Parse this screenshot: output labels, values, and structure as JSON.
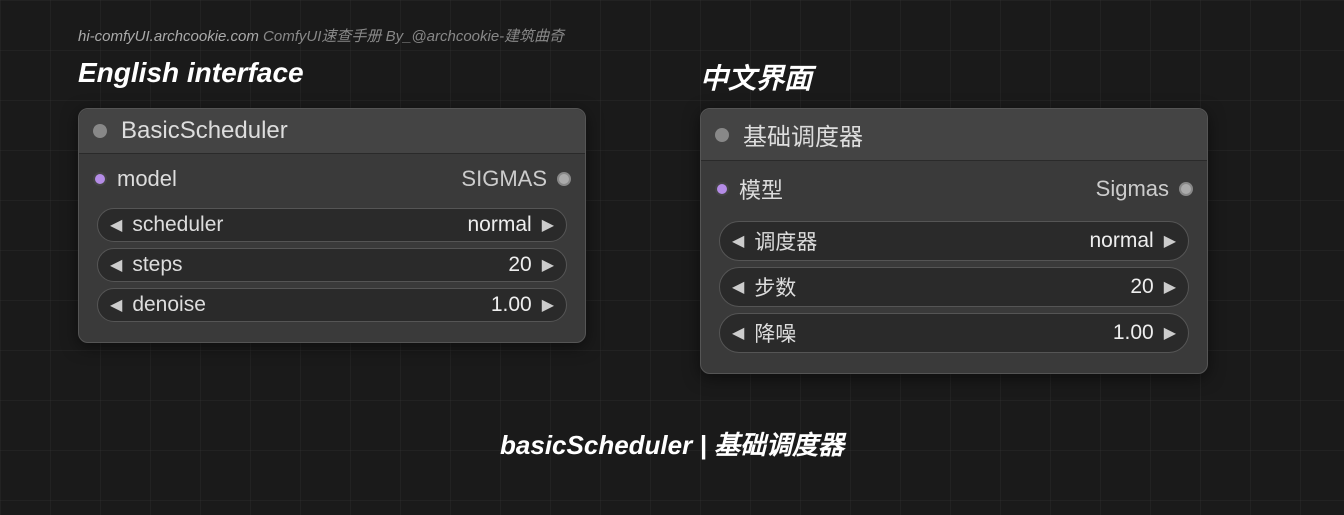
{
  "watermark": {
    "url": "hi-comfyUI.archcookie.com",
    "text": " ComfyUI速查手册 By_@archcookie-建筑曲奇"
  },
  "labels": {
    "english": "English interface",
    "chinese": "中文界面"
  },
  "caption": "basicScheduler | 基础调度器",
  "left_node": {
    "title": "BasicScheduler",
    "input_label": "model",
    "output_label": "SIGMAS",
    "widgets": {
      "scheduler": {
        "label": "scheduler",
        "value": "normal"
      },
      "steps": {
        "label": "steps",
        "value": "20"
      },
      "denoise": {
        "label": "denoise",
        "value": "1.00"
      }
    }
  },
  "right_node": {
    "title": "基础调度器",
    "input_label": "模型",
    "output_label": "Sigmas",
    "widgets": {
      "scheduler": {
        "label": "调度器",
        "value": "normal"
      },
      "steps": {
        "label": "步数",
        "value": "20"
      },
      "denoise": {
        "label": "降噪",
        "value": "1.00"
      }
    }
  }
}
